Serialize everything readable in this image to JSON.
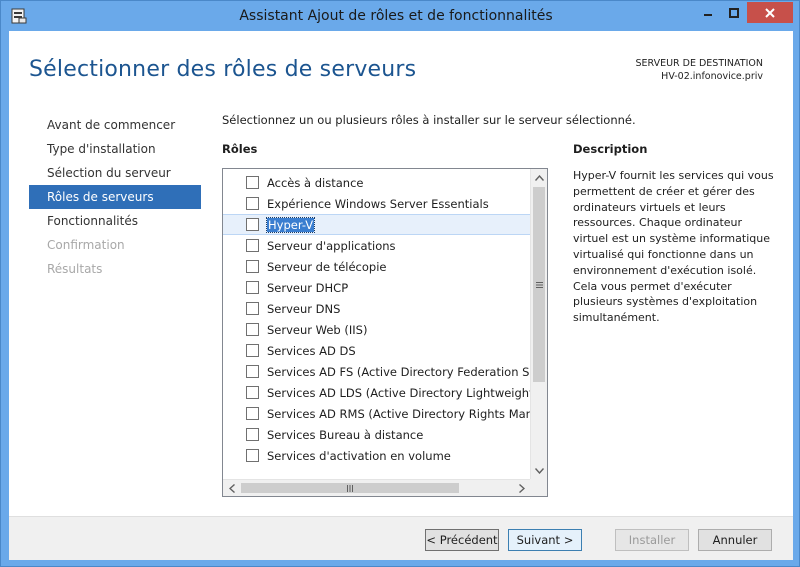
{
  "window": {
    "title": "Assistant Ajout de rôles et de fonctionnalités",
    "accent_color": "#6aa9ea",
    "close_color": "#c7504a"
  },
  "header": {
    "title": "Sélectionner des rôles de serveurs",
    "destination_label": "SERVEUR DE DESTINATION",
    "destination_server": "HV-02.infonovice.priv"
  },
  "nav": {
    "items": [
      {
        "label": "Avant de commencer",
        "state": "normal"
      },
      {
        "label": "Type d'installation",
        "state": "normal"
      },
      {
        "label": "Sélection du serveur",
        "state": "normal"
      },
      {
        "label": "Rôles de serveurs",
        "state": "active"
      },
      {
        "label": "Fonctionnalités",
        "state": "normal"
      },
      {
        "label": "Confirmation",
        "state": "disabled"
      },
      {
        "label": "Résultats",
        "state": "disabled"
      }
    ]
  },
  "content": {
    "intro": "Sélectionnez un ou plusieurs rôles à installer sur le serveur sélectionné.",
    "roles_label": "Rôles",
    "roles": [
      {
        "label": "Accès à distance",
        "checked": false
      },
      {
        "label": "Expérience Windows Server Essentials",
        "checked": false
      },
      {
        "label": "Hyper-V",
        "checked": false,
        "selected": true
      },
      {
        "label": "Serveur d'applications",
        "checked": false
      },
      {
        "label": "Serveur de télécopie",
        "checked": false
      },
      {
        "label": "Serveur DHCP",
        "checked": false
      },
      {
        "label": "Serveur DNS",
        "checked": false
      },
      {
        "label": "Serveur Web (IIS)",
        "checked": false
      },
      {
        "label": "Services AD DS",
        "checked": false
      },
      {
        "label": "Services AD FS (Active Directory Federation Services)",
        "checked": false
      },
      {
        "label": "Services AD LDS (Active Directory Lightweight Directory Services)",
        "checked": false
      },
      {
        "label": "Services AD RMS (Active Directory Rights Management Services)",
        "checked": false
      },
      {
        "label": "Services Bureau à distance",
        "checked": false
      },
      {
        "label": "Services d'activation en volume",
        "checked": false
      }
    ],
    "description_title": "Description",
    "description": "Hyper-V fournit les services qui vous permettent de créer et gérer des ordinateurs virtuels et leurs ressources. Chaque ordinateur virtuel est un système informatique virtualisé qui fonctionne dans un environnement d'exécution isolé. Cela vous permet d'exécuter plusieurs systèmes d'exploitation simultanément."
  },
  "footer": {
    "previous": "< Précédent",
    "next": "Suivant >",
    "install": "Installer",
    "cancel": "Annuler"
  }
}
